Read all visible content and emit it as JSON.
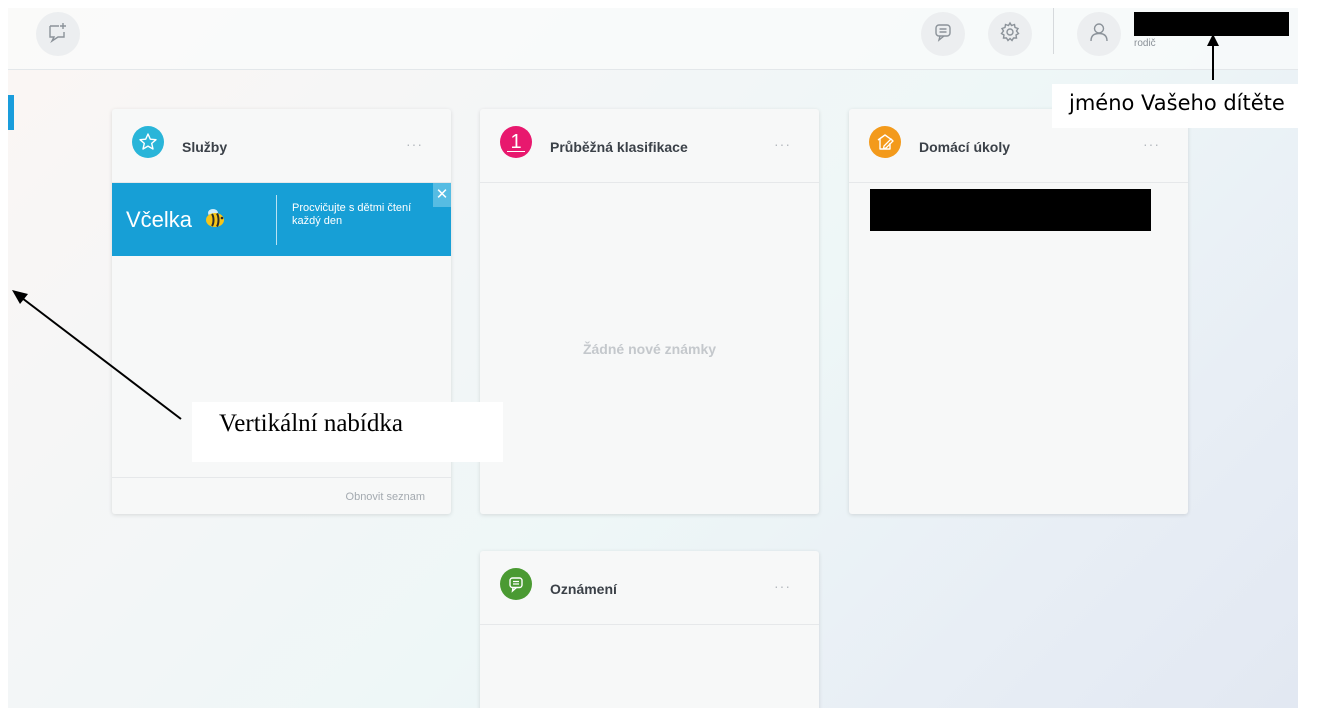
{
  "topbar": {
    "icons": {
      "new_message": "chat-plus-icon",
      "messages": "message-icon",
      "settings": "gear-icon",
      "user": "user-icon"
    },
    "user_role": "rodič"
  },
  "cards": {
    "services": {
      "title": "Služby",
      "more": "···",
      "icon": "star-icon",
      "icon_color": "#29b5d9",
      "banner": {
        "logo": "Včelka",
        "text": "Procvičujte s dětmi čtení každý den",
        "close": "✕",
        "color": "#179fd6"
      },
      "footer_link": "Obnovit seznam"
    },
    "grades": {
      "title": "Průběžná klasifikace",
      "more": "···",
      "icon": "number-one-icon",
      "icon_glyph": "1",
      "icon_color": "#e8186e",
      "empty_message": "Žádné nové známky"
    },
    "homework": {
      "title": "Domácí úkoly",
      "more": "···",
      "icon": "homework-icon",
      "icon_color": "#f39a1b"
    },
    "announcements": {
      "title": "Oznámení",
      "more": "···",
      "icon": "message-icon",
      "icon_color": "#4a9a32"
    }
  },
  "annotations": {
    "child_name": "jméno Vašeho dítěte",
    "vertical_menu": "Vertikální nabídka"
  },
  "colors": {
    "accent": "#1a9ddc"
  }
}
